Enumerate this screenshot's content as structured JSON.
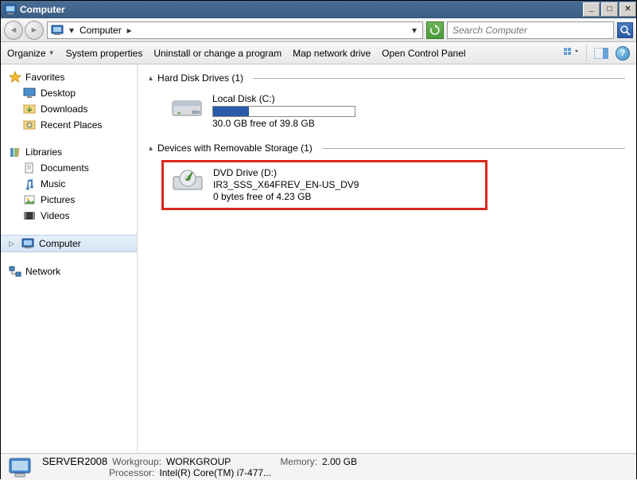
{
  "title": "Computer",
  "address": {
    "location": "Computer",
    "separator": "▸"
  },
  "search": {
    "placeholder": "Search Computer"
  },
  "toolbar": {
    "organize": "Organize",
    "system_properties": "System properties",
    "uninstall": "Uninstall or change a program",
    "map_drive": "Map network drive",
    "control_panel": "Open Control Panel"
  },
  "sidebar": {
    "favorites": {
      "label": "Favorites",
      "items": [
        "Desktop",
        "Downloads",
        "Recent Places"
      ]
    },
    "libraries": {
      "label": "Libraries",
      "items": [
        "Documents",
        "Music",
        "Pictures",
        "Videos"
      ]
    },
    "computer": {
      "label": "Computer"
    },
    "network": {
      "label": "Network"
    }
  },
  "sections": {
    "hdd": {
      "header": "Hard Disk Drives (1)",
      "drive": {
        "name": "Local Disk (C:)",
        "free_text": "30.0 GB free of 39.8 GB",
        "fill_percent": 25
      }
    },
    "removable": {
      "header": "Devices with Removable Storage (1)",
      "drive": {
        "name": "DVD Drive (D:)",
        "volume": "IR3_SSS_X64FREV_EN-US_DV9",
        "free_text": "0 bytes free of 4.23 GB"
      }
    }
  },
  "status": {
    "computer_name": "SERVER2008",
    "workgroup_label": "Workgroup:",
    "workgroup": "WORKGROUP",
    "processor_label": "Processor:",
    "processor": "Intel(R) Core(TM) i7-477...",
    "memory_label": "Memory:",
    "memory": "2.00 GB"
  }
}
